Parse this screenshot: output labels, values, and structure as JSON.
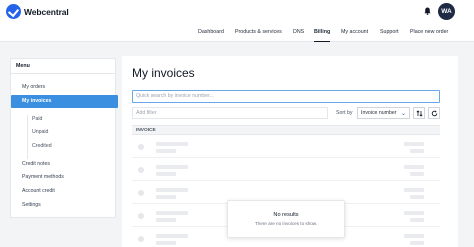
{
  "brand": {
    "name": "Webcentral"
  },
  "header": {
    "avatar_initials": "WA",
    "bell_icon": "bell-icon"
  },
  "nav": {
    "items": [
      {
        "label": "Dashboard"
      },
      {
        "label": "Products & services"
      },
      {
        "label": "DNS"
      },
      {
        "label": "Billing"
      },
      {
        "label": "My account"
      },
      {
        "label": "Support"
      },
      {
        "label": "Place new order"
      }
    ],
    "active": "Billing"
  },
  "sidebar": {
    "heading": "Menu",
    "items": [
      {
        "label": "My orders"
      },
      {
        "label": "My invoices"
      },
      {
        "label": "Paid"
      },
      {
        "label": "Unpaid"
      },
      {
        "label": "Credited"
      },
      {
        "label": "Credit notes"
      },
      {
        "label": "Payment methods"
      },
      {
        "label": "Account credit"
      },
      {
        "label": "Settings"
      }
    ],
    "active": "My invoices",
    "accent_color": "#3b8fe0"
  },
  "main": {
    "title": "My invoices",
    "search_placeholder": "Quick search by invoice number...",
    "filter_placeholder": "Add filter",
    "sort_label": "Sort by",
    "sort_value": "Invoice number",
    "column_header": "INVOICE",
    "empty_state": {
      "title": "No results",
      "subtitle": "There are no invoices to show."
    }
  }
}
